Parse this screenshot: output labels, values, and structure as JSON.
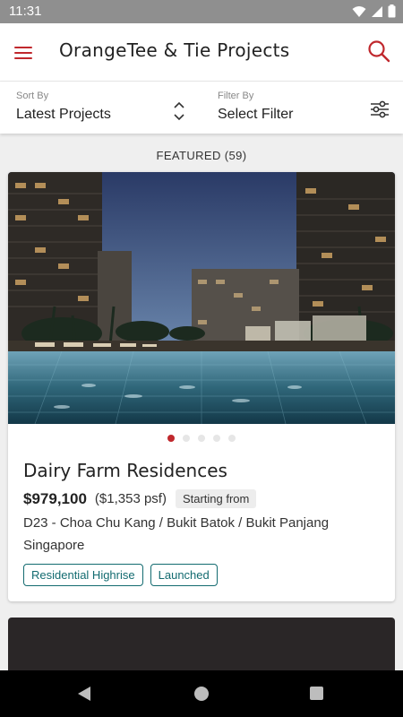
{
  "status": {
    "time": "11:31"
  },
  "header": {
    "title": "OrangeTee & Tie Projects"
  },
  "filters": {
    "sort_label": "Sort By",
    "sort_value": "Latest Projects",
    "filter_label": "Filter By",
    "filter_value": "Select Filter"
  },
  "featured_label": "FEATURED (59)",
  "featured_project": {
    "name": "Dairy Farm Residences",
    "price": "$979,100",
    "psf": "($1,353 psf)",
    "price_note": "Starting from",
    "district": "D23 - Choa Chu Kang / Bukit Batok / Bukit Panjang",
    "country": "Singapore",
    "tags": [
      "Residential Highrise",
      "Launched"
    ],
    "carousel_count": 5,
    "carousel_active": 1
  },
  "colors": {
    "accent": "#c0282d",
    "tag": "#136b70"
  }
}
